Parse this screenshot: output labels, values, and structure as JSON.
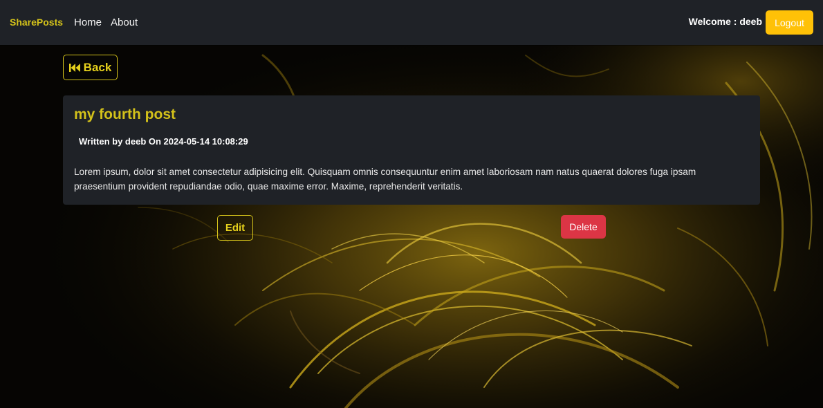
{
  "navbar": {
    "brand": "SharePosts",
    "links": [
      {
        "label": "Home"
      },
      {
        "label": "About"
      }
    ],
    "welcome": "Welcome : deeb",
    "logout_label": "Logout"
  },
  "actions": {
    "back_label": "Back",
    "edit_label": "Edit",
    "delete_label": "Delete"
  },
  "post": {
    "title": "my fourth post",
    "meta": "Written by deeb On 2024-05-14 10:08:29",
    "body": "Lorem ipsum, dolor sit amet consectetur adipisicing elit. Quisquam omnis consequuntur enim amet laboriosam nam natus quaerat dolores fuga ipsam praesentium provident repudiandae odio, quae maxime error. Maxime, reprehenderit veritatis."
  },
  "colors": {
    "accent": "#d4c21a",
    "navbar_bg": "#1f2227",
    "logout_bg": "#ffc107",
    "delete_bg": "#dc3545"
  },
  "icons": {
    "back": "backward-icon"
  }
}
